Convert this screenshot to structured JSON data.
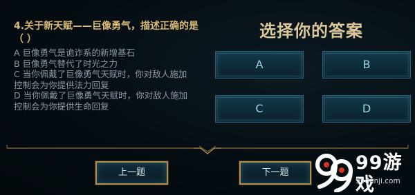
{
  "question": {
    "title": "4.关于新天赋——巨像勇气，描述正确的是（ ）",
    "options": [
      "A 巨像勇气是诡诈系的新增基石",
      "B 巨像勇气替代了时光之力",
      "C 当你佩戴了巨像勇气天赋时，你对敌人施加",
      "控制会为你提供法力回复",
      "D 当你佩戴了巨像勇气天赋时，你对敌人施加",
      "控制会为你提供生命回复"
    ]
  },
  "answer_panel": {
    "heading": "选择你的答案",
    "buttons": [
      "A",
      "B",
      "C",
      "D"
    ]
  },
  "navigation": {
    "prev_label": "上一题",
    "next_label": "下一题"
  },
  "watermark": {
    "logo_text": "99游戏",
    "url": "99danji.com"
  },
  "colors": {
    "question_title": "#d7b977",
    "option_text": "#8b9aa3",
    "heading": "#dcc79a",
    "answer_button_fill": "#0e2a38",
    "answer_button_border": "#2d5e73",
    "nav_border_gold": "#b08e4f",
    "background": "#030b10"
  }
}
